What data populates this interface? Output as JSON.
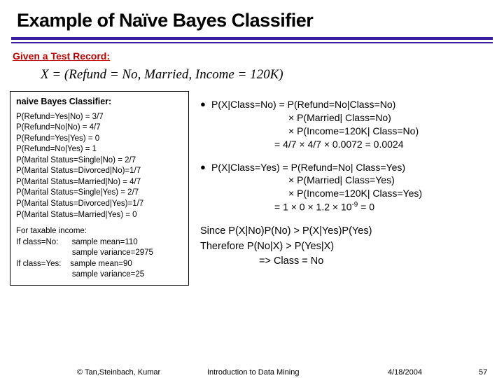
{
  "title": "Example of Naïve Bayes Classifier",
  "given_label": "Given a Test Record:",
  "record": "X = (Refund = No, Married, Income = 120K)",
  "leftbox": {
    "header": "naive Bayes Classifier:",
    "lines": [
      "P(Refund=Yes|No) = 3/7",
      "P(Refund=No|No) = 4/7",
      "P(Refund=Yes|Yes) = 0",
      "P(Refund=No|Yes) = 1",
      "P(Marital Status=Single|No) = 2/7",
      "P(Marital Status=Divorced|No)=1/7",
      "P(Marital Status=Married|No) = 4/7",
      "P(Marital Status=Single|Yes) = 2/7",
      "P(Marital Status=Divorced|Yes)=1/7",
      "P(Marital Status=Married|Yes) = 0"
    ],
    "income_header": "For taxable income:",
    "income": [
      "If class=No:      sample mean=110",
      "                         sample variance=2975",
      "If class=Yes:    sample mean=90",
      "                         sample variance=25"
    ]
  },
  "bullets": {
    "b1": {
      "l1": "P(X|Class=No) = P(Refund=No|Class=No)",
      "l2": "× P(Married| Class=No)",
      "l3": "× P(Income=120K| Class=No)",
      "l4": "= 4/7 × 4/7 × 0.0072 = 0.0024"
    },
    "b2": {
      "l1": "P(X|Class=Yes) = P(Refund=No| Class=Yes)",
      "l2": "× P(Married| Class=Yes)",
      "l3": "× P(Income=120K| Class=Yes)",
      "l4a": "= 1 × 0 × 1.2 × 10",
      "l4b": " = 0"
    }
  },
  "concl": {
    "l1": "Since P(X|No)P(No) > P(X|Yes)P(Yes)",
    "l2": "Therefore P(No|X) > P(Yes|X)",
    "l3": "=> Class = No"
  },
  "footer": {
    "copyright": "© Tan,Steinbach, Kumar",
    "mid": "Introduction to Data Mining",
    "date": "4/18/2004",
    "num": "57"
  }
}
